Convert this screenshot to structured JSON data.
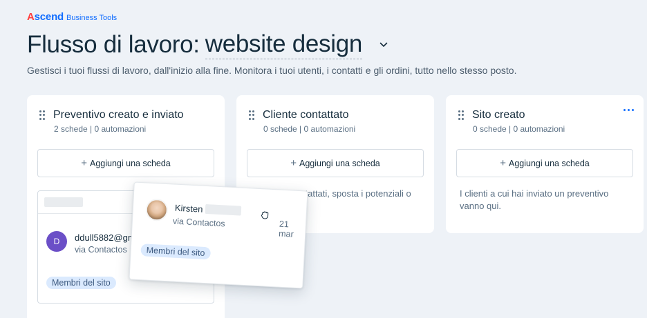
{
  "brand": {
    "name_a": "A",
    "name_rest": "scend",
    "sub": "Business Tools"
  },
  "header": {
    "title_prefix": "Flusso di lavoro:",
    "workflow_name": "website design",
    "subtitle": "Gestisci i tuoi flussi di lavoro, dall'inizio alla fine. Monitora i tuoi utenti, i contatti e gli ordini, tutto nello stesso posto."
  },
  "columns": [
    {
      "title": "Preventivo creato e inviato",
      "meta": "2 schede |  0 automazioni",
      "add_label": "Aggiungi una scheda",
      "card": {
        "email": "ddull5882@gmail.com",
        "source": "via Contactos",
        "tag": "Membri del sito"
      }
    },
    {
      "title": "Cliente contattato",
      "meta": "0 schede |  0 automazioni",
      "add_label": "Aggiungi una scheda",
      "empty_text": "Una volta contattati, sposta i potenziali                 o passaggio."
    },
    {
      "title": "Sito creato",
      "meta": "0 schede |  0 automazioni",
      "add_label": "Aggiungi una scheda",
      "empty_text": "I clienti a cui hai inviato un preventivo vanno qui."
    }
  ],
  "dragging_card": {
    "name": "Kirsten",
    "source": "via Contactos",
    "date": "21 mar",
    "tag": "Membri del sito"
  },
  "icons": {
    "column_handle": "drag-handle-icon",
    "more": "more-icon",
    "plus": "plus-icon",
    "dropdown": "chevron-down-icon",
    "grab": "grab-hand-icon"
  },
  "colors": {
    "background": "#eef2f7",
    "accent": "#116dff",
    "brand_red": "#ff4040",
    "text": "#162d3d",
    "muted": "#5a6f83",
    "tag_bg": "#dbeafe",
    "avatar_purple": "#6b4fc7"
  }
}
